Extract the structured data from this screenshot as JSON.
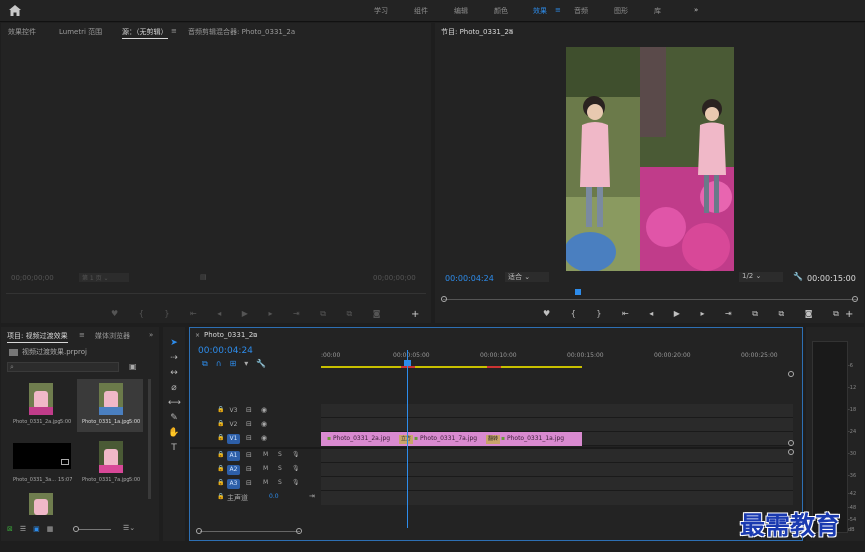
{
  "workspaces": [
    "学习",
    "组件",
    "编辑",
    "颜色",
    "效果",
    "音频",
    "图形",
    "库"
  ],
  "active_workspace": "效果",
  "source_panel": {
    "tabs": [
      "效果控件",
      "Lumetri 范围",
      "源：（无剪辑）",
      "音频剪辑混合器: Photo_0331_2a"
    ],
    "timecode_left": "00;00;00;00",
    "timecode_right": "00;00;00;00",
    "fit_label": "第 1 页"
  },
  "program_panel": {
    "title": "节目: Photo_0331_2a",
    "timecode": "00:00:04:24",
    "fit": "适合",
    "quality": "1/2",
    "duration": "00:00:15:00"
  },
  "project_panel": {
    "tabs": [
      "项目: 视频过渡效果",
      "媒体浏览器"
    ],
    "project_file": "视频过渡效果.prproj",
    "search_placeholder": "",
    "items": [
      {
        "name": "Photo_0331_2a.jpg",
        "duration": "5:00",
        "thumb": "pink-girl"
      },
      {
        "name": "Photo_0331_1a.jpg",
        "duration": "5:00",
        "thumb": "pink-girl",
        "selected": true
      },
      {
        "name": "Photo_0331_3a...",
        "duration": "15:07",
        "thumb": "dark"
      },
      {
        "name": "Photo_0331_7a.jpg",
        "duration": "5:00",
        "thumb": "pink-girl"
      },
      {
        "name": "",
        "duration": "",
        "thumb": "pink-girl"
      }
    ]
  },
  "timeline": {
    "sequence": "Photo_0331_2a",
    "timecode": "00:00:04:24",
    "ruler": [
      ":00:00",
      "00:00:05:00",
      "00:00:10:00",
      "00:00:15:00",
      "00:00:20:00",
      "00:00:25:00"
    ],
    "video_tracks": [
      "V3",
      "V2",
      "V1"
    ],
    "audio_tracks": [
      "A1",
      "A2",
      "A3"
    ],
    "master_label": "主声道",
    "master_value": "0.0",
    "clips": [
      {
        "name": "Photo_0331_2a.jpg",
        "track": "V1",
        "start": 0,
        "end": 5
      },
      {
        "name": "Photo_0331_7a.jpg",
        "track": "V1",
        "start": 5,
        "end": 10
      },
      {
        "name": "Photo_0331_1a.jpg",
        "track": "V1",
        "start": 10,
        "end": 15
      }
    ],
    "transitions": [
      "立方",
      "翻转"
    ],
    "playhead": 4.96
  },
  "meter_labels": [
    "-6",
    "-12",
    "-18",
    "-24",
    "-30",
    "-36",
    "-42",
    "-48",
    "-54",
    "dB"
  ],
  "watermark": "最需教育",
  "colors": {
    "accent": "#2d8ceb",
    "clip": "#d98ad0",
    "bg": "#232323"
  }
}
